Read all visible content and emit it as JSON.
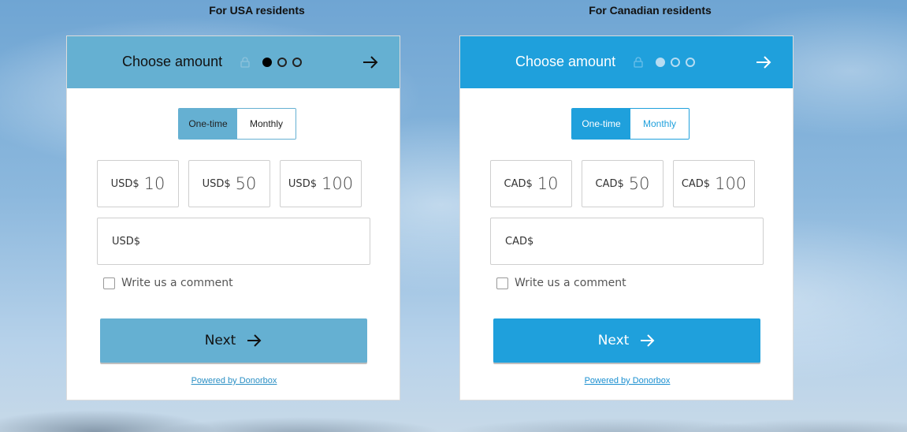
{
  "columns": [
    {
      "title": "For USA residents",
      "header_title": "Choose amount",
      "toggle": {
        "one_time": "One-time",
        "monthly": "Monthly"
      },
      "amounts": [
        {
          "currency": "USD$",
          "value": "10"
        },
        {
          "currency": "USD$",
          "value": "50"
        },
        {
          "currency": "USD$",
          "value": "100"
        }
      ],
      "custom_currency": "USD$",
      "comment_label": "Write us a comment",
      "next_label": "Next",
      "powered_by": "Powered by Donorbox",
      "colors": {
        "accent": "#65b0d2",
        "header_text": "#111111",
        "dot_active": "#000000",
        "dot_inactive": "#222222"
      }
    },
    {
      "title": "For Canadian residents",
      "header_title": "Choose amount",
      "toggle": {
        "one_time": "One-time",
        "monthly": "Monthly"
      },
      "amounts": [
        {
          "currency": "CAD$",
          "value": "10"
        },
        {
          "currency": "CAD$",
          "value": "50"
        },
        {
          "currency": "CAD$",
          "value": "100"
        }
      ],
      "custom_currency": "CAD$",
      "comment_label": "Write us a comment",
      "next_label": "Next",
      "powered_by": "Powered by Donorbox",
      "colors": {
        "accent": "#1fa0dc",
        "header_text": "#ffffff",
        "dot_active": "#b6dcf2",
        "dot_inactive": "#b6dcf2"
      }
    }
  ],
  "icons": {
    "lock": "lock-icon",
    "arrow": "arrow-right-icon",
    "step_dots": "step-dots"
  }
}
